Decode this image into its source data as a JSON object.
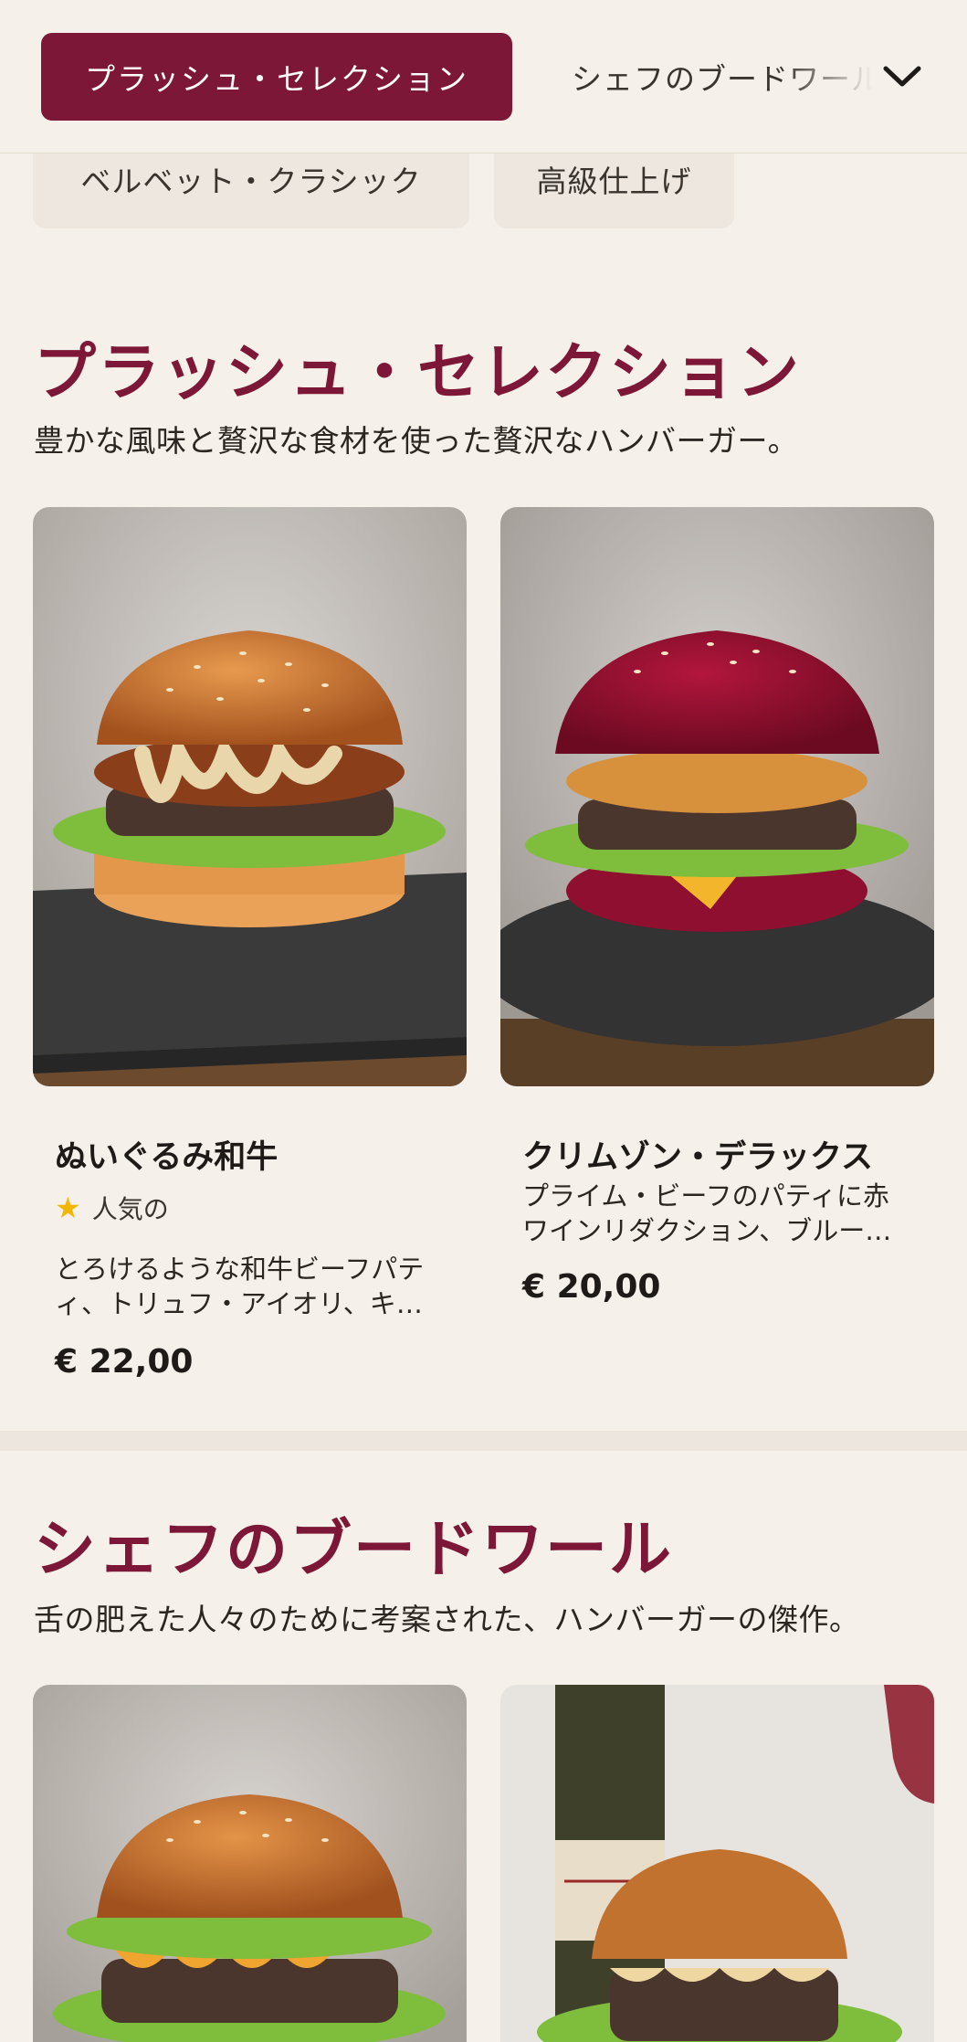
{
  "header": {
    "active_tab": "プラッシュ・セレクション",
    "next_tab": "シェフのブードワール"
  },
  "chips": [
    "ベルベット・クラシック",
    "高級仕上げ"
  ],
  "sections": [
    {
      "title": "プラッシュ・セレクション",
      "description": "豊かな風味と贅沢な食材を使った贅沢なハンバーガー。",
      "items": [
        {
          "name": "ぬいぐるみ和牛",
          "badge": "人気の",
          "description": "とろけるような和牛ビーフパティ、トリュフ・アイオリ、キャラメリゼしたオニオン",
          "price": "€ 22,00"
        },
        {
          "name": "クリムゾン・デラックス",
          "description": "プライム・ビーフのパティに赤ワインリダクション、ブルーチーズ",
          "price": "€ 20,00"
        }
      ]
    },
    {
      "title": "シェフのブードワール",
      "description": "舌の肥えた人々のために考案された、ハンバーガーの傑作。"
    }
  ],
  "colors": {
    "accent": "#7D1737",
    "background": "#F5F1EA",
    "chip": "#EDE7E0",
    "star": "#F2B705"
  },
  "icons": {
    "header_toggle": "chevron-down-icon",
    "popular": "star-icon"
  }
}
